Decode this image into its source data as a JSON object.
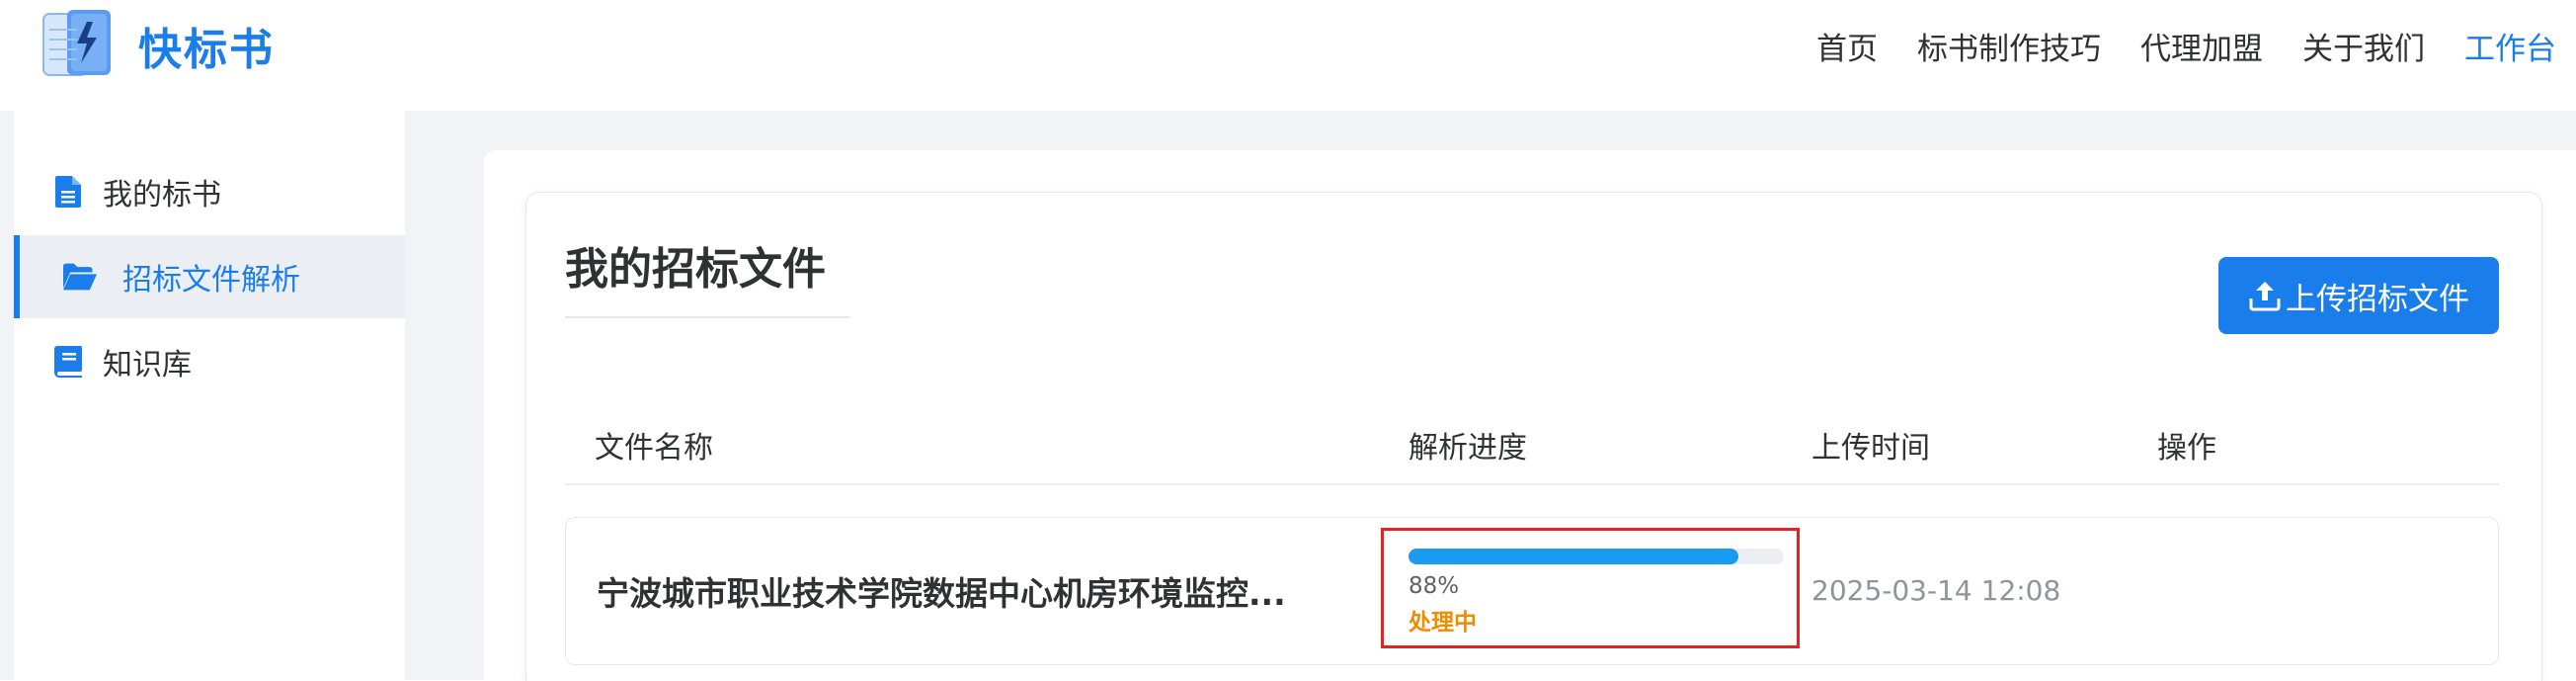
{
  "app": {
    "name": "快标书",
    "accent": "#1a7dec"
  },
  "nav": [
    {
      "label": "首页",
      "active": false
    },
    {
      "label": "标书制作技巧",
      "active": false
    },
    {
      "label": "代理加盟",
      "active": false
    },
    {
      "label": "关于我们",
      "active": false
    },
    {
      "label": "工作台",
      "active": true
    }
  ],
  "sidebar": {
    "items": [
      {
        "label": "我的标书",
        "icon": "document-icon",
        "active": false
      },
      {
        "label": "招标文件解析",
        "icon": "folder-open-icon",
        "active": true
      },
      {
        "label": "知识库",
        "icon": "book-icon",
        "active": false
      }
    ]
  },
  "page": {
    "title": "我的招标文件",
    "upload_button": "上传招标文件"
  },
  "table": {
    "columns": [
      "文件名称",
      "解析进度",
      "上传时间",
      "操作"
    ],
    "rows": [
      {
        "file_name": "宁波城市职业技术学院数据中心机房环境监控...",
        "progress": 0.88,
        "progress_label": "88%",
        "status": "处理中",
        "upload_time": "2025-03-14 12:08"
      }
    ]
  },
  "colors": {
    "progress": "#1a9bf0",
    "status_processing": "#f08c00",
    "highlight_border": "#e02424"
  }
}
